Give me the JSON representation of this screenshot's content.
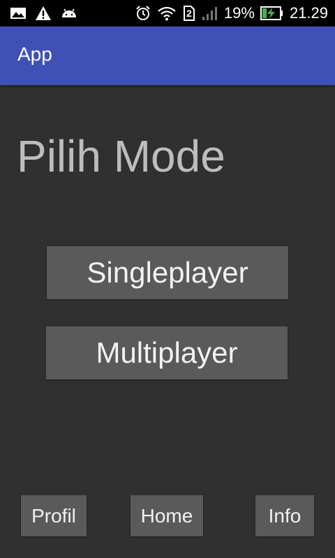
{
  "status_bar": {
    "battery_percent": "19%",
    "time": "21.29",
    "sim_slot": "2",
    "icons": [
      "image-icon",
      "warning-icon",
      "android-icon",
      "alarm-icon",
      "wifi-icon",
      "sim-icon",
      "signal-icon",
      "battery-charging-icon"
    ]
  },
  "app_bar": {
    "title": "App",
    "color": "#3f51b5"
  },
  "main": {
    "heading": "Pilih Mode",
    "single_label": "Singleplayer",
    "multi_label": "Multiplayer"
  },
  "bottom_nav": {
    "profil_label": "Profil",
    "home_label": "Home",
    "info_label": "Info"
  }
}
